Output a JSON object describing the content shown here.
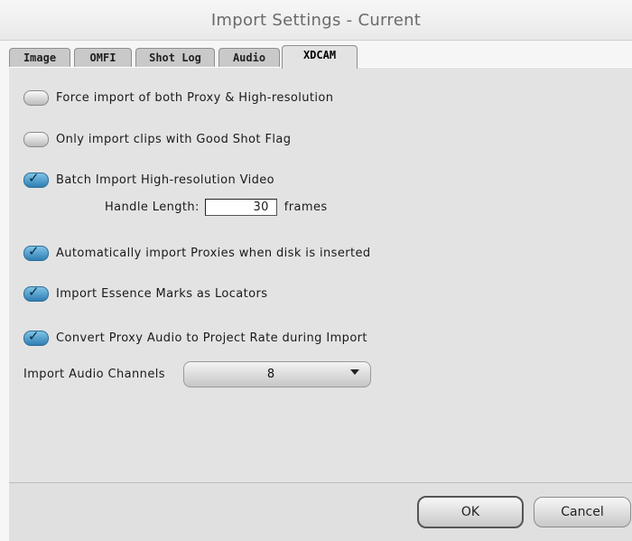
{
  "window": {
    "title": "Import Settings - Current"
  },
  "tabs": [
    {
      "label": "Image"
    },
    {
      "label": "OMFI"
    },
    {
      "label": "Shot Log"
    },
    {
      "label": "Audio"
    },
    {
      "label": "XDCAM",
      "selected": true
    }
  ],
  "options": [
    {
      "label": "Force import of both Proxy & High-resolution",
      "checked": false
    },
    {
      "label": "Only import clips with Good Shot Flag",
      "checked": false
    },
    {
      "label": "Batch Import High-resolution Video",
      "checked": true
    },
    {
      "label": "Automatically import Proxies when disk is inserted",
      "checked": true
    },
    {
      "label": "Import Essence Marks as Locators",
      "checked": true
    },
    {
      "label": "Convert Proxy Audio to Project Rate during Import",
      "checked": true
    }
  ],
  "handle_length": {
    "label": "Handle Length:",
    "value": "30",
    "unit": "frames"
  },
  "audio_channels": {
    "label": "Import Audio Channels",
    "value": "8"
  },
  "buttons": {
    "ok": "OK",
    "cancel": "Cancel"
  }
}
